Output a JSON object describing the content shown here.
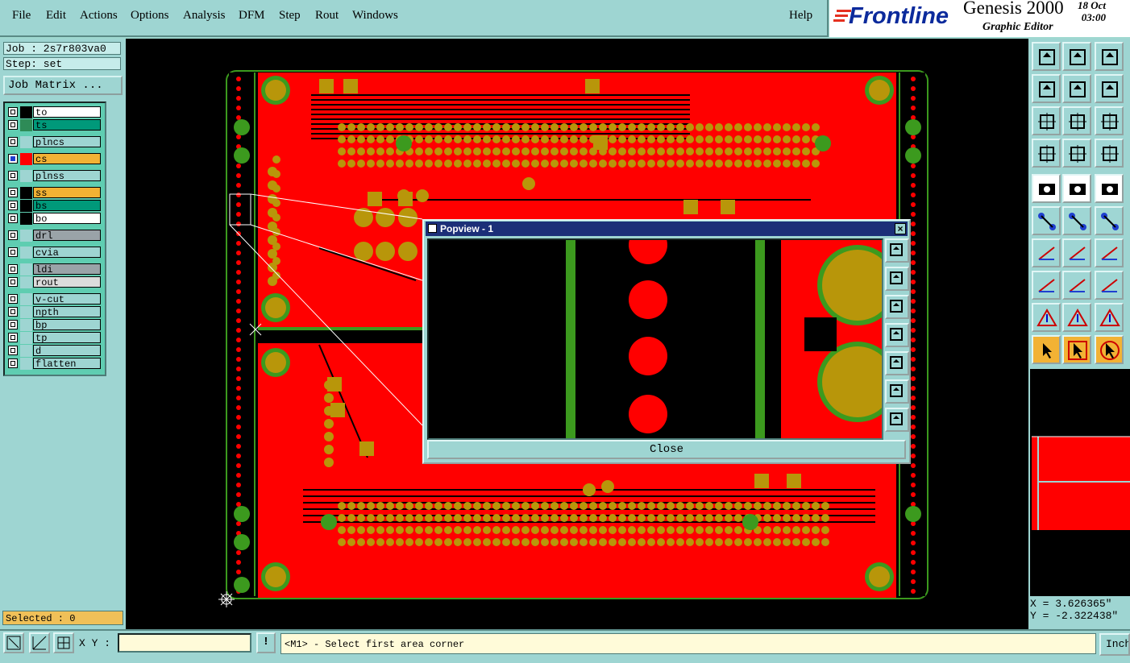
{
  "menubar": {
    "items": [
      "File",
      "Edit",
      "Actions",
      "Options",
      "Analysis",
      "DFM",
      "Step",
      "Rout",
      "Windows"
    ],
    "help": "Help"
  },
  "brand": {
    "logo": "Frontline",
    "product": "Genesis 2000",
    "subtitle": "Graphic Editor",
    "date": "18 Oct",
    "time": "03:00"
  },
  "left": {
    "job": "Job : 2s7r803va0",
    "step": "Step: set",
    "job_matrix": "Job Matrix ...",
    "layers": [
      {
        "name": "to",
        "color": "#000000",
        "bg": "#ffffff"
      },
      {
        "name": "ts",
        "color": "#2e8b57",
        "bg": "#00997a"
      },
      {
        "name": "plncs",
        "color": "#9ed5d2",
        "bg": "#9ed5d2"
      },
      {
        "name": "cs",
        "color": "#ff0000",
        "bg": "#f2b234",
        "active": true
      },
      {
        "name": "plnss",
        "color": "#9ed5d2",
        "bg": "#9ed5d2"
      },
      {
        "name": "ss",
        "color": "#000000",
        "bg": "#f2b234"
      },
      {
        "name": "bs",
        "color": "#000000",
        "bg": "#00997a"
      },
      {
        "name": "bo",
        "color": "#000000",
        "bg": "#ffffff"
      },
      {
        "name": "drl",
        "color": "#9ed5d2",
        "bg": "#9aa3a8"
      },
      {
        "name": "cvia",
        "color": "#9ed5d2",
        "bg": "#9ed5d2"
      },
      {
        "name": "ldi",
        "color": "#9ed5d2",
        "bg": "#9aa3a8"
      },
      {
        "name": "rout",
        "color": "#9ed5d2",
        "bg": "#dcdcdc"
      },
      {
        "name": "v-cut",
        "color": "#9ed5d2",
        "bg": "#9ed5d2"
      },
      {
        "name": "npth",
        "color": "#9ed5d2",
        "bg": "#9ed5d2"
      },
      {
        "name": "bp",
        "color": "#9ed5d2",
        "bg": "#9ed5d2"
      },
      {
        "name": "tp",
        "color": "#9ed5d2",
        "bg": "#9ed5d2"
      },
      {
        "name": "d",
        "color": "#9ed5d2",
        "bg": "#9ed5d2"
      },
      {
        "name": "flatten",
        "color": "#9ed5d2",
        "bg": "#9ed5d2"
      }
    ],
    "selected": "Selected : 0"
  },
  "right": {
    "x": "X = 3.626365\"",
    "y": "Y = -2.322438\""
  },
  "bottom": {
    "xy_label": "X Y :",
    "xy_value": "",
    "bang": "!",
    "message": "<M1> - Select first area corner",
    "units": "Inch"
  },
  "popup": {
    "title": "Popview - 1",
    "close": "Close"
  },
  "colors": {
    "copper": "#ff0000",
    "pad": "#b8960a",
    "mask": "#3c9a1e",
    "panel": "#9ed5d2"
  }
}
